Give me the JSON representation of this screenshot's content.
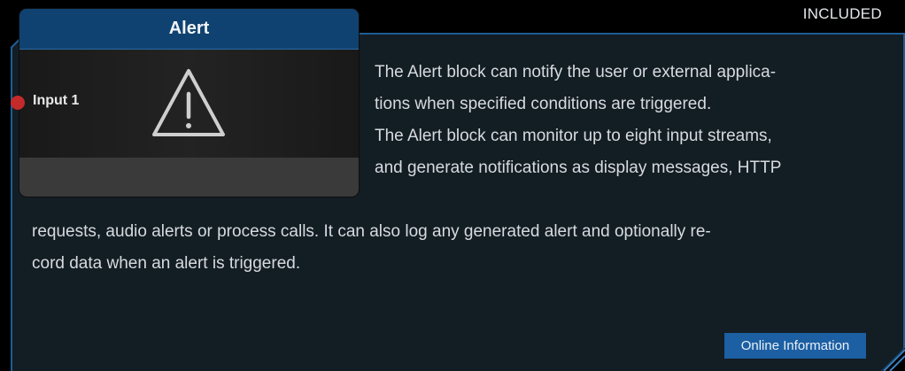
{
  "badge": "INCLUDED",
  "block": {
    "title": "Alert",
    "input_label": "Input 1",
    "icon": "warning-triangle-icon"
  },
  "description": {
    "line1": "The Alert block can notify the user or external applica-",
    "line2": "tions when specified conditions are triggered.",
    "line3": "The Alert block can monitor up to eight input streams,",
    "line4": "and generate notifications as display messages, HTTP",
    "line5": "requests, audio alerts or process calls. It can also log any generated alert and optionally re-",
    "line6": "cord data when an alert is triggered."
  },
  "online_button": "Online Information",
  "colors": {
    "panel_bg": "#131d24",
    "panel_border": "#1f5d92",
    "header_blue": "#0f4270",
    "button_blue": "#1c5fa3",
    "port_red": "#c42a2a"
  }
}
